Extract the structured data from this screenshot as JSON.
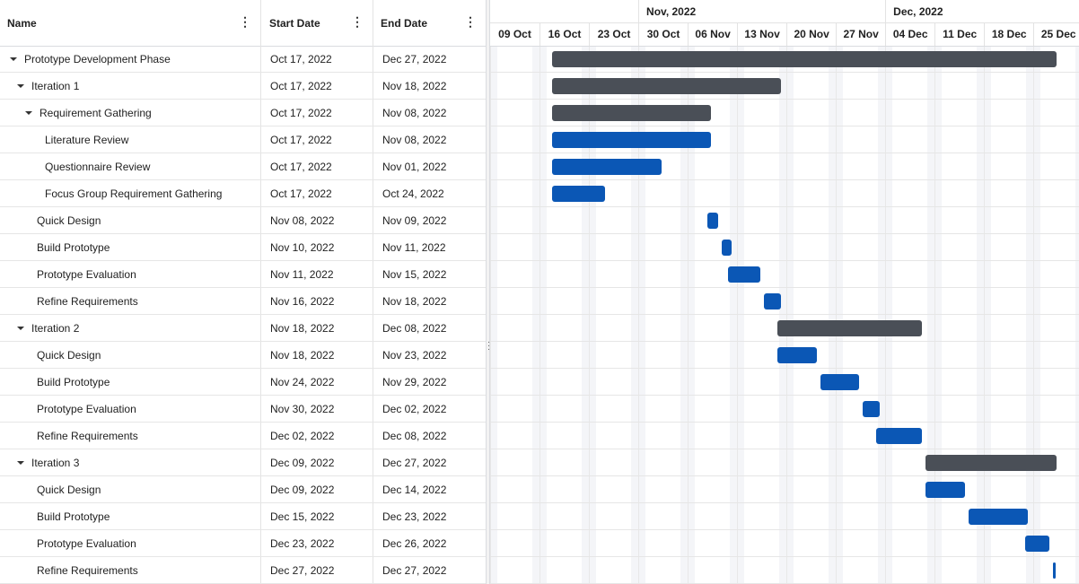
{
  "colors": {
    "parent_bar": "#4a4f57",
    "task_bar": "#0b57b5",
    "grid_line": "#e6e6e6",
    "weekend_shade": "#f4f5f8"
  },
  "grid": {
    "columns": [
      {
        "label": "Name",
        "menu_icon": "more-vertical-icon"
      },
      {
        "label": "Start Date",
        "menu_icon": "more-vertical-icon"
      },
      {
        "label": "End Date",
        "menu_icon": "more-vertical-icon"
      }
    ],
    "rows": [
      {
        "name": "Prototype Development Phase",
        "start": "Oct 17, 2022",
        "end": "Dec 27, 2022",
        "level": 0,
        "expandable": true
      },
      {
        "name": "Iteration 1",
        "start": "Oct 17, 2022",
        "end": "Nov 18, 2022",
        "level": 1,
        "expandable": true
      },
      {
        "name": "Requirement Gathering",
        "start": "Oct 17, 2022",
        "end": "Nov 08, 2022",
        "level": 2,
        "expandable": true
      },
      {
        "name": "Literature Review",
        "start": "Oct 17, 2022",
        "end": "Nov 08, 2022",
        "level": 3,
        "expandable": false
      },
      {
        "name": "Questionnaire Review",
        "start": "Oct 17, 2022",
        "end": "Nov 01, 2022",
        "level": 3,
        "expandable": false
      },
      {
        "name": "Focus Group Requirement Gathering",
        "start": "Oct 17, 2022",
        "end": "Oct 24, 2022",
        "level": 3,
        "expandable": false
      },
      {
        "name": "Quick Design",
        "start": "Nov 08, 2022",
        "end": "Nov 09, 2022",
        "level": 2,
        "expandable": false
      },
      {
        "name": "Build Prototype",
        "start": "Nov 10, 2022",
        "end": "Nov 11, 2022",
        "level": 2,
        "expandable": false
      },
      {
        "name": "Prototype Evaluation",
        "start": "Nov 11, 2022",
        "end": "Nov 15, 2022",
        "level": 2,
        "expandable": false
      },
      {
        "name": "Refine Requirements",
        "start": "Nov 16, 2022",
        "end": "Nov 18, 2022",
        "level": 2,
        "expandable": false
      },
      {
        "name": "Iteration 2",
        "start": "Nov 18, 2022",
        "end": "Dec 08, 2022",
        "level": 1,
        "expandable": true
      },
      {
        "name": "Quick Design",
        "start": "Nov 18, 2022",
        "end": "Nov 23, 2022",
        "level": 2,
        "expandable": false
      },
      {
        "name": "Build Prototype",
        "start": "Nov 24, 2022",
        "end": "Nov 29, 2022",
        "level": 2,
        "expandable": false
      },
      {
        "name": "Prototype Evaluation",
        "start": "Nov 30, 2022",
        "end": "Dec 02, 2022",
        "level": 2,
        "expandable": false
      },
      {
        "name": "Refine Requirements",
        "start": "Dec 02, 2022",
        "end": "Dec 08, 2022",
        "level": 2,
        "expandable": false
      },
      {
        "name": "Iteration 3",
        "start": "Dec 09, 2022",
        "end": "Dec 27, 2022",
        "level": 1,
        "expandable": true
      },
      {
        "name": "Quick Design",
        "start": "Dec 09, 2022",
        "end": "Dec 14, 2022",
        "level": 2,
        "expandable": false
      },
      {
        "name": "Build Prototype",
        "start": "Dec 15, 2022",
        "end": "Dec 23, 2022",
        "level": 2,
        "expandable": false
      },
      {
        "name": "Prototype Evaluation",
        "start": "Dec 23, 2022",
        "end": "Dec 26, 2022",
        "level": 2,
        "expandable": false
      },
      {
        "name": "Refine Requirements",
        "start": "Dec 27, 2022",
        "end": "Dec 27, 2022",
        "level": 2,
        "expandable": false
      }
    ]
  },
  "timeline": {
    "months": [
      {
        "label": "",
        "start": "Oct 09, 2022"
      },
      {
        "label": "Nov, 2022",
        "start": "Oct 30, 2022"
      },
      {
        "label": "Dec, 2022",
        "start": "Dec 04, 2022"
      }
    ],
    "weeks": [
      "09 Oct",
      "16 Oct",
      "23 Oct",
      "30 Oct",
      "06 Nov",
      "13 Nov",
      "20 Nov",
      "27 Nov",
      "04 Dec",
      "11 Dec",
      "18 Dec",
      "25 Dec"
    ],
    "first_day": "Oct 09, 2022"
  }
}
